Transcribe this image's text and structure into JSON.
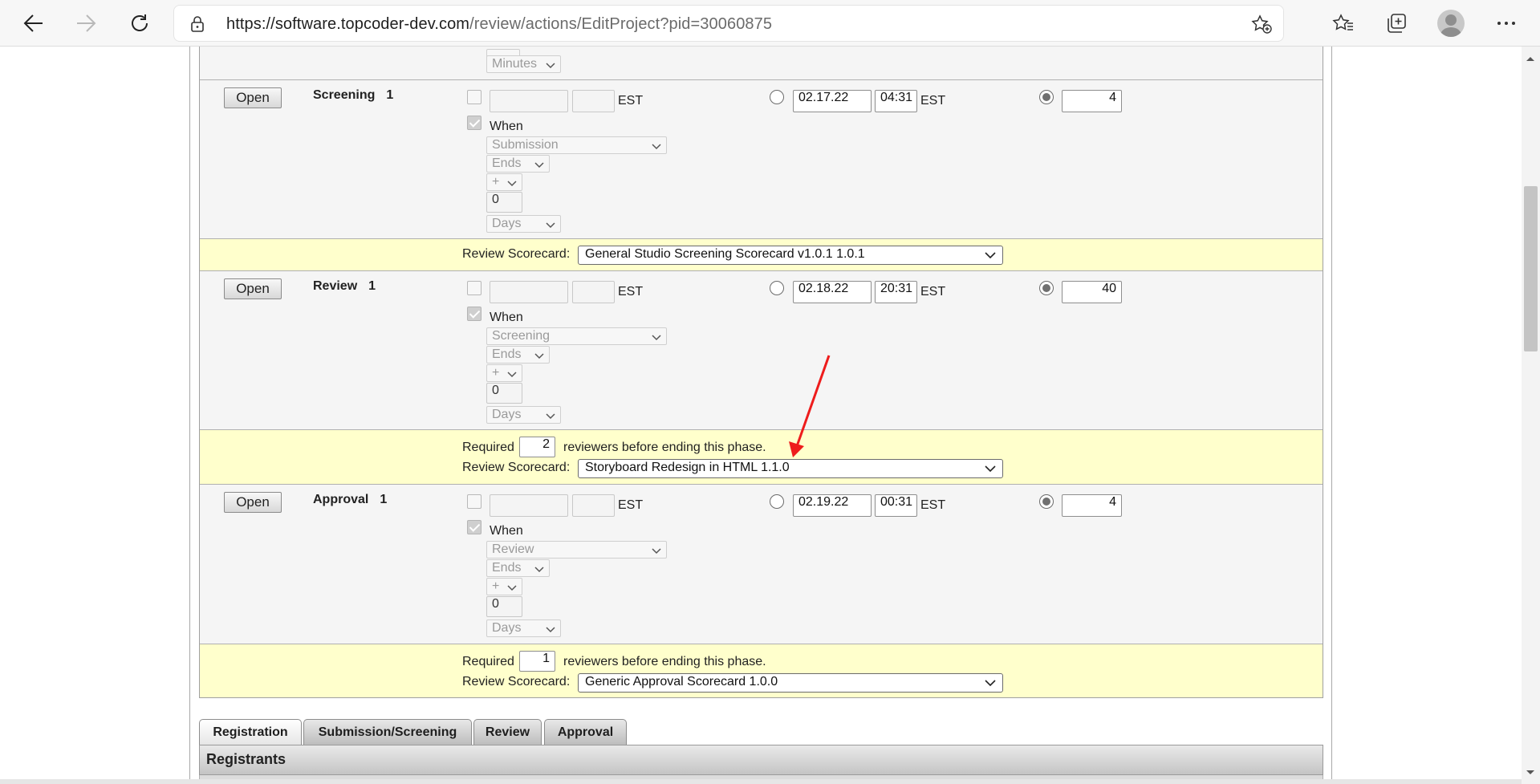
{
  "browser": {
    "url_host": "https://software.topcoder-dev.com",
    "url_path": "/review/actions/EditProject?pid=30060875",
    "icons": [
      "back-icon",
      "forward-icon",
      "refresh-icon",
      "lock-icon",
      "add-favorite-icon",
      "favorites-icon",
      "collections-icon",
      "profile-icon",
      "more-icon"
    ]
  },
  "top_partial": {
    "unit": "Minutes"
  },
  "phases": [
    {
      "open_label": "Open",
      "name": "Screening",
      "number": "1",
      "tz": "EST",
      "when_label": "When",
      "when_phase": "Submission",
      "when_event": "Ends",
      "offset_sign": "+",
      "offset_value": "0",
      "offset_unit": "Days",
      "end_date": "02.17.22",
      "end_time": "04:31",
      "end_tz": "EST",
      "duration": "4"
    },
    {
      "open_label": "Open",
      "name": "Review",
      "number": "1",
      "tz": "EST",
      "when_label": "When",
      "when_phase": "Screening",
      "when_event": "Ends",
      "offset_sign": "+",
      "offset_value": "0",
      "offset_unit": "Days",
      "end_date": "02.18.22",
      "end_time": "20:31",
      "end_tz": "EST",
      "duration": "40"
    },
    {
      "open_label": "Open",
      "name": "Approval",
      "number": "1",
      "tz": "EST",
      "when_label": "When",
      "when_phase": "Review",
      "when_event": "Ends",
      "offset_sign": "+",
      "offset_value": "0",
      "offset_unit": "Days",
      "end_date": "02.19.22",
      "end_time": "00:31",
      "end_tz": "EST",
      "duration": "4"
    }
  ],
  "scorecards": {
    "screening": {
      "label": "Review Scorecard:",
      "value": "General Studio Screening Scorecard v1.0.1 1.0.1"
    },
    "review": {
      "required_label": "Required",
      "required_value": "2",
      "required_suffix": "reviewers before ending this phase.",
      "label": "Review Scorecard:",
      "value": "Storyboard Redesign in HTML 1.1.0"
    },
    "approval": {
      "required_label": "Required",
      "required_value": "1",
      "required_suffix": "reviewers before ending this phase.",
      "label": "Review Scorecard:",
      "value": "Generic Approval Scorecard 1.0.0"
    }
  },
  "tabs": [
    "Registration",
    "Submission/Screening",
    "Review",
    "Approval"
  ],
  "active_tab": "Registration",
  "registrants_header": "Registrants",
  "annotation_color": "#ee1c1c"
}
